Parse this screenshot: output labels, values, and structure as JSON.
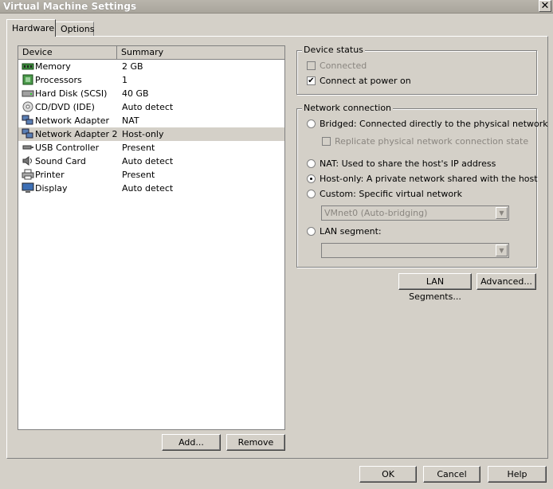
{
  "window": {
    "title": "Virtual Machine Settings",
    "close_glyph": "✕"
  },
  "tabs": [
    {
      "label": "Hardware"
    },
    {
      "label": "Options"
    }
  ],
  "device_list": {
    "headers": {
      "device": "Device",
      "summary": "Summary"
    },
    "rows": [
      {
        "device": "Memory",
        "summary": "2 GB",
        "icon": "memory-icon"
      },
      {
        "device": "Processors",
        "summary": "1",
        "icon": "processor-icon"
      },
      {
        "device": "Hard Disk (SCSI)",
        "summary": "40 GB",
        "icon": "hard-disk-icon"
      },
      {
        "device": "CD/DVD (IDE)",
        "summary": "Auto detect",
        "icon": "cd-dvd-icon"
      },
      {
        "device": "Network Adapter",
        "summary": "NAT",
        "icon": "network-adapter-icon"
      },
      {
        "device": "Network Adapter 2",
        "summary": "Host-only",
        "icon": "network-adapter-icon",
        "selected": true
      },
      {
        "device": "USB Controller",
        "summary": "Present",
        "icon": "usb-icon"
      },
      {
        "device": "Sound Card",
        "summary": "Auto detect",
        "icon": "sound-card-icon"
      },
      {
        "device": "Printer",
        "summary": "Present",
        "icon": "printer-icon"
      },
      {
        "device": "Display",
        "summary": "Auto detect",
        "icon": "display-icon"
      }
    ]
  },
  "list_buttons": {
    "add": "Add...",
    "remove": "Remove"
  },
  "device_status": {
    "label": "Device status",
    "connected": {
      "label": "Connected",
      "checked": false,
      "enabled": false
    },
    "connect_at_power_on": {
      "label": "Connect at power on",
      "checked": true
    }
  },
  "network_connection": {
    "label": "Network connection",
    "bridged": "Bridged: Connected directly to the physical network",
    "replicate": "Replicate physical network connection state",
    "nat": "NAT: Used to share the host's IP address",
    "host_only": "Host-only: A private network shared with the host",
    "custom": "Custom: Specific virtual network",
    "custom_value": "VMnet0 (Auto-bridging)",
    "lan_segment": "LAN segment:",
    "lan_segment_value": "",
    "selected": "host_only"
  },
  "network_buttons": {
    "lan_segments": "LAN Segments...",
    "advanced": "Advanced..."
  },
  "dialog_buttons": {
    "ok": "OK",
    "cancel": "Cancel",
    "help": "Help"
  },
  "colors": {
    "face": "#d4d0c8",
    "selected_row": "#d4d0c8"
  }
}
